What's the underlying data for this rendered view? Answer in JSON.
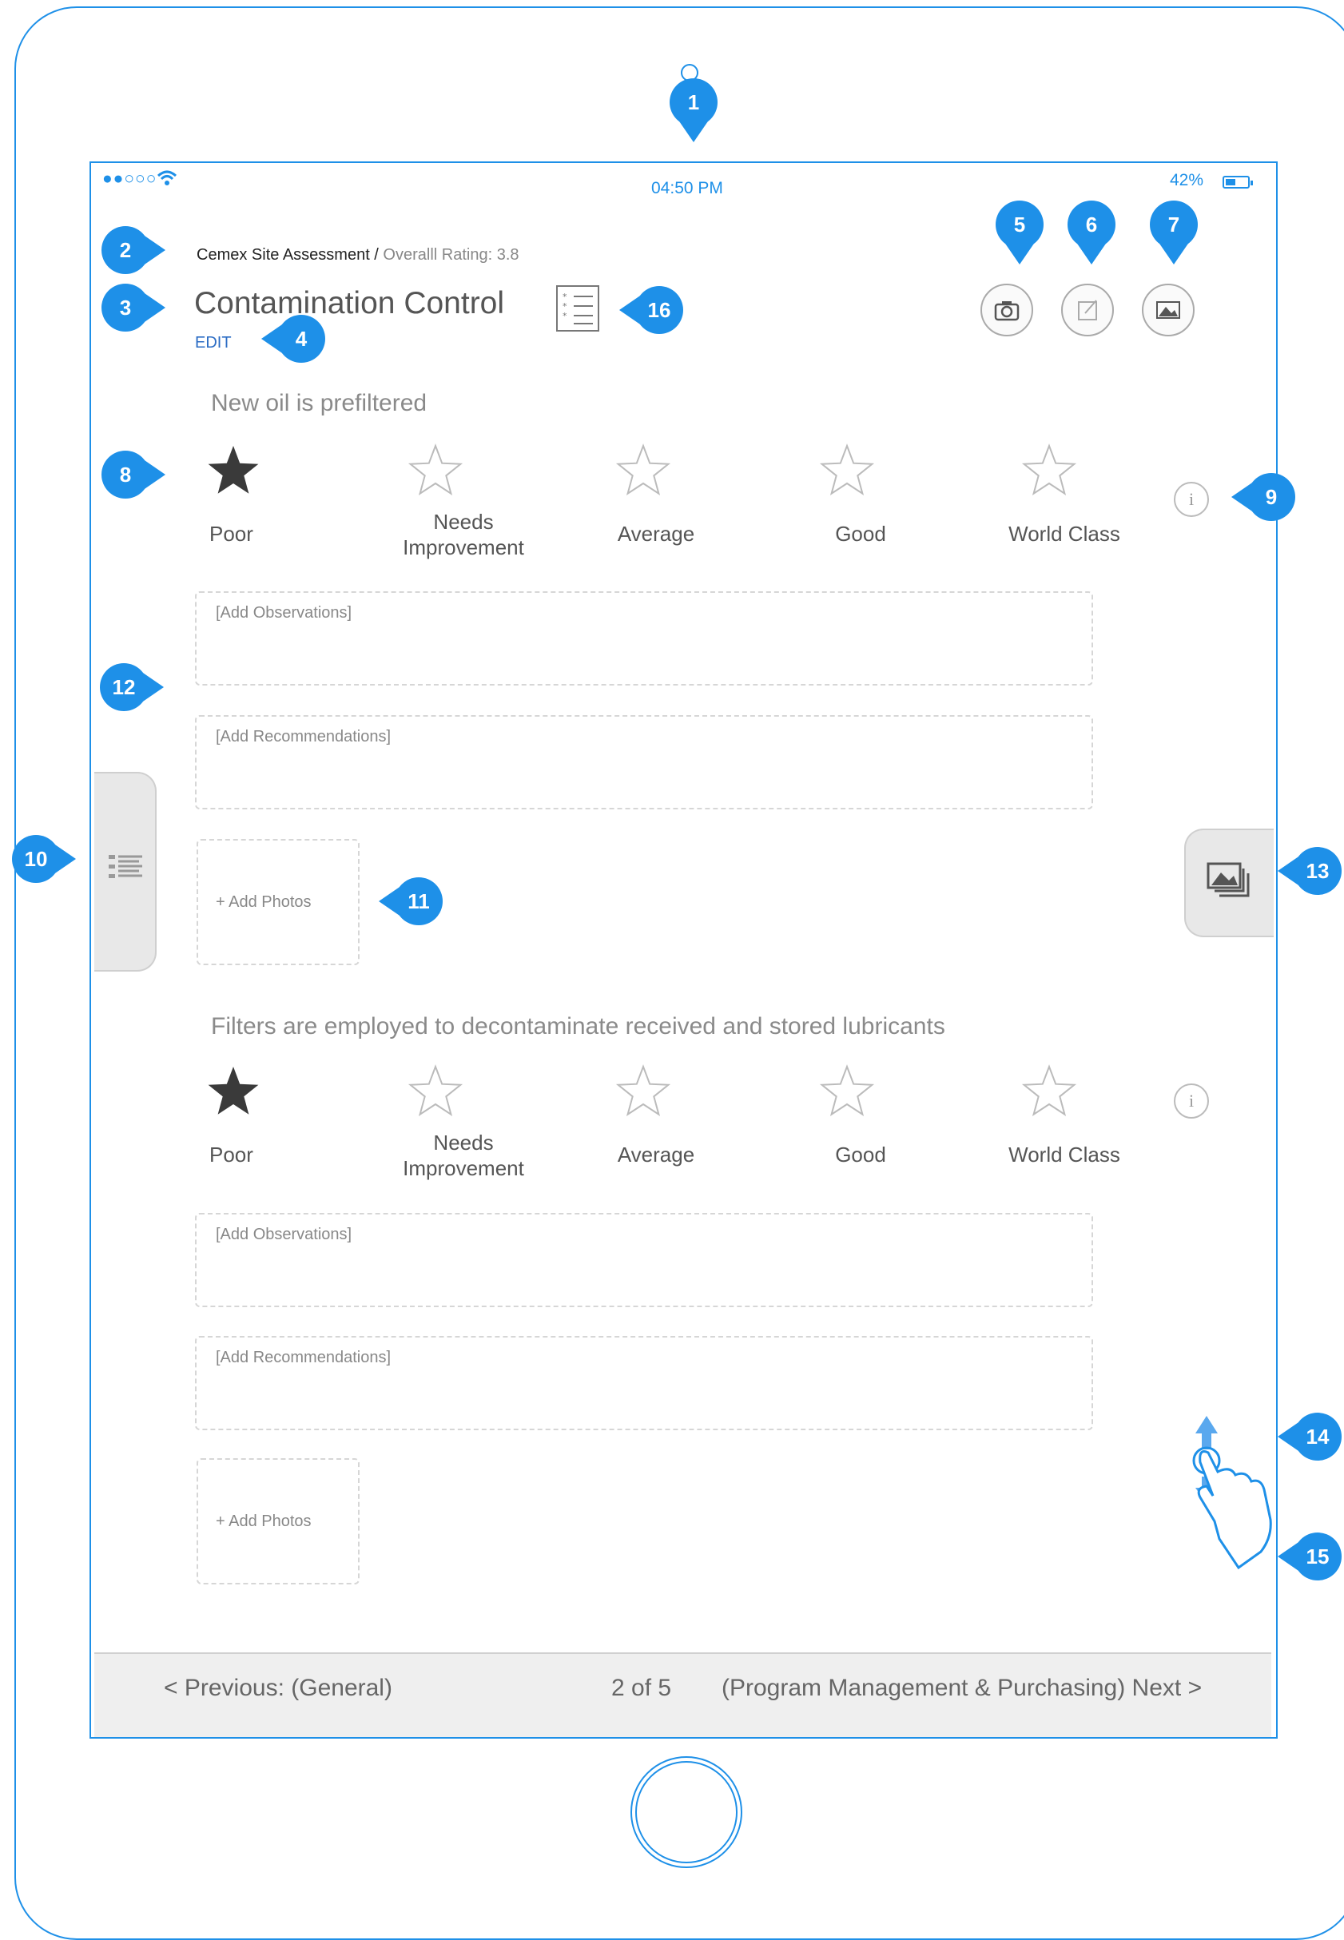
{
  "status_bar": {
    "signal": "●●○○○",
    "time": "04:50 PM",
    "battery": "42%"
  },
  "header": {
    "breadcrumb_main": "Cemex Site Assessment",
    "breadcrumb_sep": " / ",
    "breadcrumb_rating": "Overalll Rating: 3.8",
    "title": "Contamination Control",
    "edit_label": "EDIT"
  },
  "toolbar": {
    "camera_icon": "camera-icon",
    "note_icon": "edit-note-icon",
    "gallery_icon": "gallery-icon"
  },
  "rating_labels": [
    "Poor",
    "Needs Improvement",
    "Average",
    "Good",
    "World Class"
  ],
  "questions": [
    {
      "text": "New oil is prefiltered",
      "selected_rating": 1,
      "observations_placeholder": "[Add Observations]",
      "recommendations_placeholder": "[Add Recommendations]",
      "add_photos_label": "+ Add Photos"
    },
    {
      "text": "Filters are employed to decontaminate received and stored lubricants",
      "selected_rating": 1,
      "observations_placeholder": "[Add Observations]",
      "recommendations_placeholder": "[Add Recommendations]",
      "add_photos_label": "+ Add Photos"
    }
  ],
  "footer": {
    "previous": "< Previous: (General)",
    "page": "2 of 5",
    "next": "(Program Management & Purchasing)  Next >"
  },
  "callouts": [
    "1",
    "2",
    "3",
    "4",
    "5",
    "6",
    "7",
    "8",
    "9",
    "10",
    "11",
    "12",
    "13",
    "14",
    "15",
    "16"
  ],
  "colors": {
    "accent": "#1e90e8",
    "link": "#2b6cc4",
    "star_filled": "#3a3a3a",
    "star_empty": "#bbbbbb",
    "footer_bg": "#efefef"
  }
}
